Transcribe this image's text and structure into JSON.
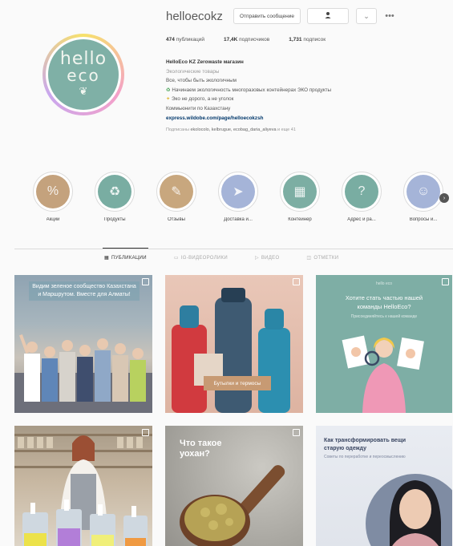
{
  "profile": {
    "username": "helloecokz",
    "avatar_line1": "hello",
    "avatar_line2": "eco",
    "message_button": "Отправить сообщение",
    "stats": {
      "posts_count": "474",
      "posts_label": "публикаций",
      "followers_count": "17,4K",
      "followers_label": "подписчиков",
      "following_count": "1,731",
      "following_label": "подписок"
    },
    "bio": {
      "name": "HelloEco KZ Zerowaste магазин",
      "category": "Экологические товары",
      "line1": "Все, чтобы быть экологичным",
      "line2": "Начинаем экологичность многоразовых контейнерах ЭКО продукты",
      "line3": "Эко не дорого, а не уголок",
      "line4": "Коммьюнити по Казахстану",
      "link": "express.wildobe.com/page/helloecokzsh",
      "followed_by_prefix": "Подписаны",
      "followed_by_names": "ekolocolo, kelbrugue, ecobag_daria_aliyeva",
      "followed_by_more": "еще 41"
    }
  },
  "highlights": [
    {
      "label": "Акции",
      "color": "#c4a27d",
      "icon": "percent-icon"
    },
    {
      "label": "Продукты",
      "color": "#79ada2",
      "icon": "recycle-icon"
    },
    {
      "label": "Отзывы",
      "color": "#c8a77e",
      "icon": "chat-icon"
    },
    {
      "label": "Доставка и...",
      "color": "#a5b4d8",
      "icon": "truck-icon"
    },
    {
      "label": "Контейнер",
      "color": "#7caea3",
      "icon": "box-icon"
    },
    {
      "label": "Адрес и ра...",
      "color": "#79ada2",
      "icon": "question-icon"
    },
    {
      "label": "Вопросы и...",
      "color": "#a5b4d8",
      "icon": "person-icon"
    }
  ],
  "tabs": [
    {
      "label": "ПУБЛИКАЦИИ",
      "icon": "grid-icon",
      "active": true
    },
    {
      "label": "IG-ВИДЕОРОЛИКИ",
      "icon": "tv-icon",
      "active": false
    },
    {
      "label": "ВИДЕО",
      "icon": "video-icon",
      "active": false
    },
    {
      "label": "ОТМЕТКИ",
      "icon": "tag-icon",
      "active": false
    }
  ],
  "posts": {
    "p1_title": "Видим зеленое сообщество Казахстана и Маршрутом. Вместе для Алматы!",
    "p2_caption": "Бутылки и термосы",
    "p3_brand": "hello eco",
    "p3_title": "Хотите стать частью нашей команды HelloEco?",
    "p3_sub": "Присоединяйтесь к нашей команде",
    "p5_title": "Что такое уохан?",
    "p6_title": "Как трансформировать вещи старую одежду",
    "p6_sub": "Советы по переработке и переосмыслению"
  },
  "colors": {
    "accent": "#00376b",
    "avatar_bg": "#7fb0a6"
  }
}
